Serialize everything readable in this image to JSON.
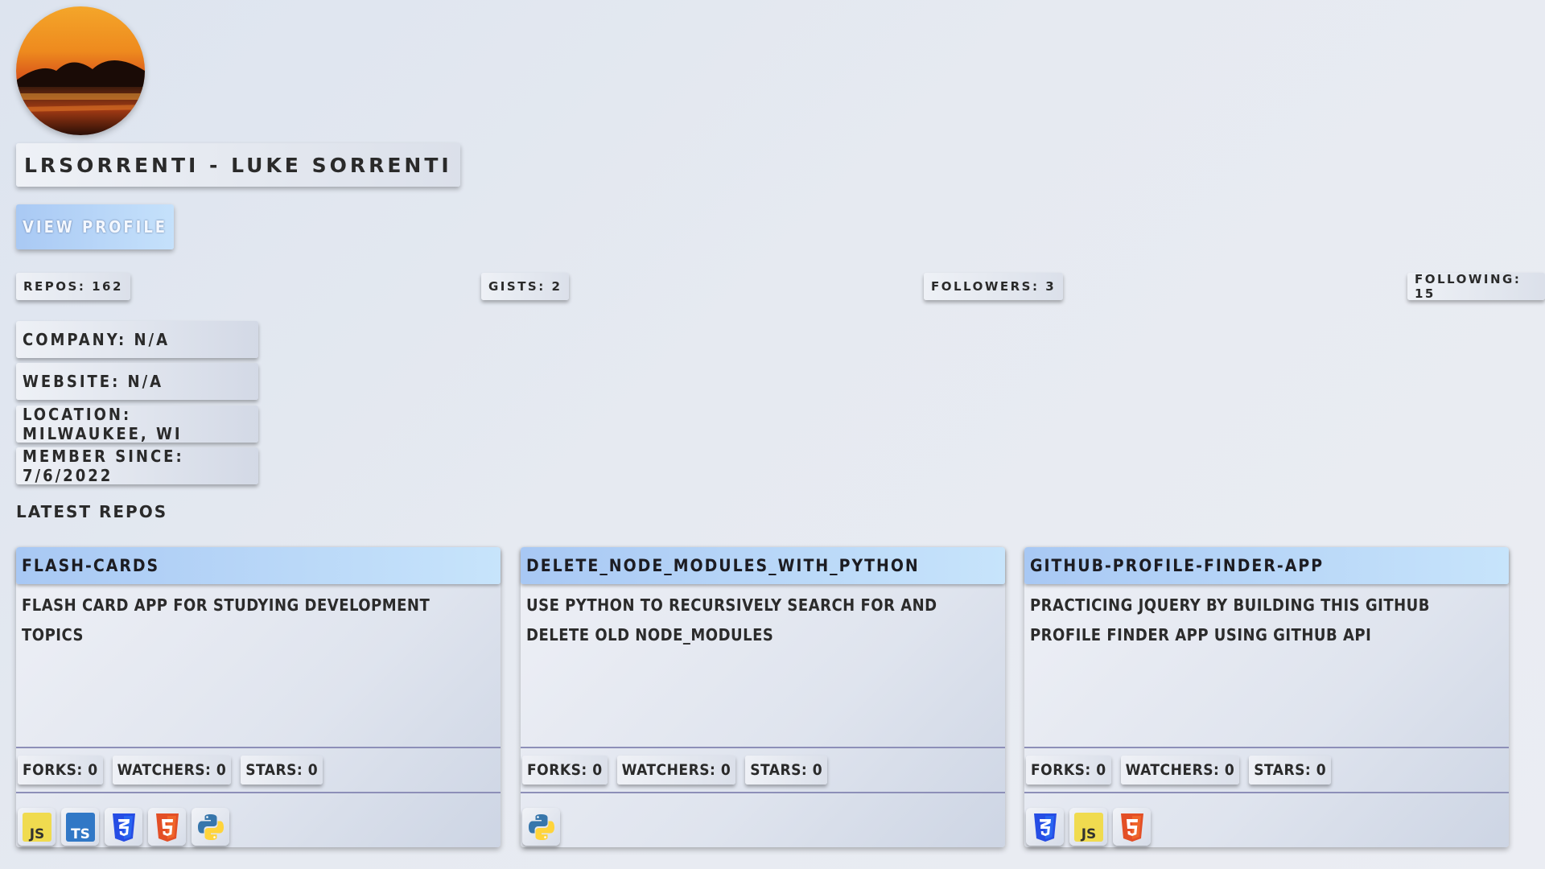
{
  "profile": {
    "avatar_alt": "sunset-avatar",
    "name": "LRSORRENTI - LUKE SORRENTI",
    "view_profile_label": "VIEW PROFILE"
  },
  "stats": {
    "repos": "REPOS: 162",
    "gists": "GISTS: 2",
    "followers": "FOLLOWERS: 3",
    "following": "FOLLOWING: 15"
  },
  "info": {
    "company": "COMPANY: N/A",
    "website": "WEBSITE: N/A",
    "location": "LOCATION: MILWAUKEE, WI",
    "member_since": "MEMBER SINCE: 7/6/2022"
  },
  "latest_repos_title": "LATEST REPOS",
  "repos": [
    {
      "name": "FLASH-CARDS",
      "description": "FLASH CARD APP FOR STUDYING DEVELOPMENT TOPICS",
      "forks": "FORKS: 0",
      "watchers": "WATCHERS: 0",
      "stars": "STARS: 0",
      "languages": [
        "javascript-icon",
        "typescript-icon",
        "css3-icon",
        "html5-icon",
        "python-icon"
      ]
    },
    {
      "name": "DELETE_NODE_MODULES_WITH_PYTHON",
      "description": "USE PYTHON TO RECURSIVELY SEARCH FOR AND DELETE OLD NODE_MODULES",
      "forks": "FORKS: 0",
      "watchers": "WATCHERS: 0",
      "stars": "STARS: 0",
      "languages": [
        "python-icon"
      ]
    },
    {
      "name": "GITHUB-PROFILE-FINDER-APP",
      "description": "PRACTICING JQUERY BY BUILDING THIS GITHUB PROFILE FINDER APP USING GITHUB API",
      "forks": "FORKS: 0",
      "watchers": "WATCHERS: 0",
      "stars": "STARS: 0",
      "languages": [
        "css3-icon",
        "javascript-icon",
        "html5-icon"
      ]
    }
  ],
  "colors": {
    "accent_header": "#a8c8f4",
    "divider": "#8d8fb8",
    "js": "#f0db4f",
    "ts": "#3178c6",
    "css": "#264de4",
    "html": "#e34f26",
    "python_blue": "#3776ab",
    "python_yellow": "#ffd43b"
  }
}
